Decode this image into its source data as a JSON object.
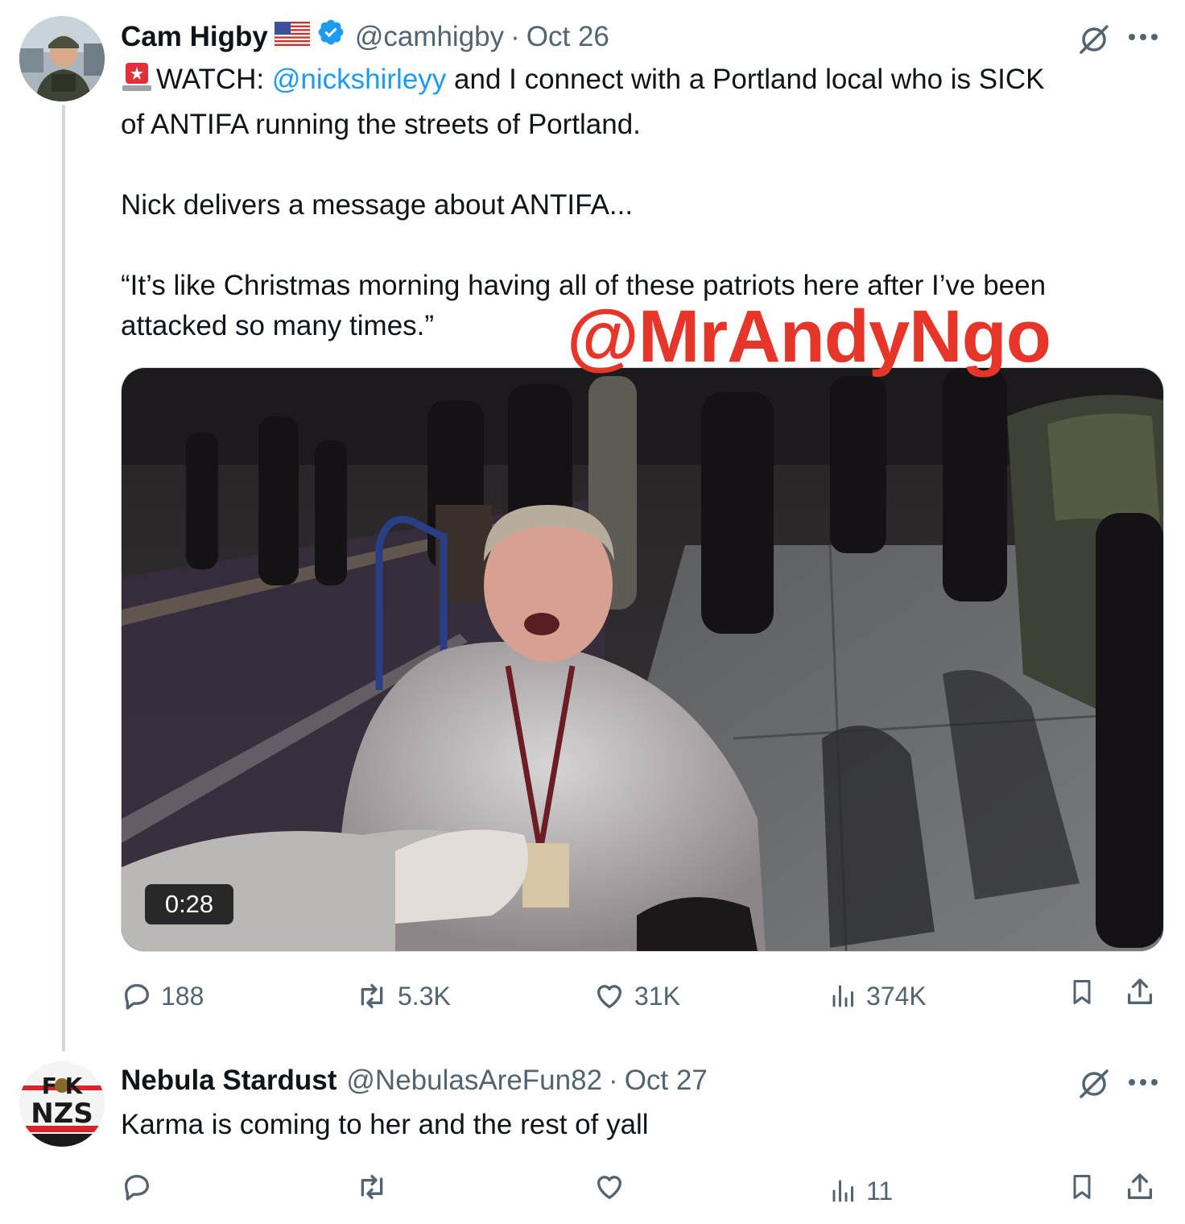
{
  "tweet1": {
    "display_name": "Cam Higby",
    "handle": "@camhigby",
    "separator": "·",
    "date": "Oct 26",
    "line1_prefix": "WATCH: ",
    "mention": "@nickshirleyy",
    "line1_suffix": " and I connect with a Portland local who is SICK",
    "line2": "of ANTIFA running the streets of Portland.",
    "para2": "Nick delivers a message about ANTIFA...",
    "para3_line1": "“It’s like Christmas morning having all of these patriots here after I’ve been",
    "para3_line2": "attacked so many times.”",
    "video_duration": "0:28",
    "stats": {
      "replies": "188",
      "reposts": "5.3K",
      "likes": "31K",
      "views": "374K"
    }
  },
  "watermark": "@MrAndyNgo",
  "tweet2": {
    "display_name": "Nebula Stardust",
    "handle": "@NebulasAreFun82",
    "separator": "·",
    "date": "Oct 27",
    "text": "Karma is coming to her and the rest of yall",
    "avatar_text_top": "F🐵K",
    "avatar_text_bottom": "NZS",
    "stats": {
      "views": "11"
    }
  },
  "colors": {
    "accent": "#1d9bf0",
    "secondary_text": "#536471",
    "watermark": "#e8352a",
    "thread_line": "#cfd9de"
  },
  "icons": [
    "verified-badge-icon",
    "us-flag-icon",
    "grok-icon",
    "more-icon",
    "reply-icon",
    "repost-icon",
    "like-icon",
    "views-icon",
    "bookmark-icon",
    "share-icon",
    "alarm-emoji-icon"
  ]
}
